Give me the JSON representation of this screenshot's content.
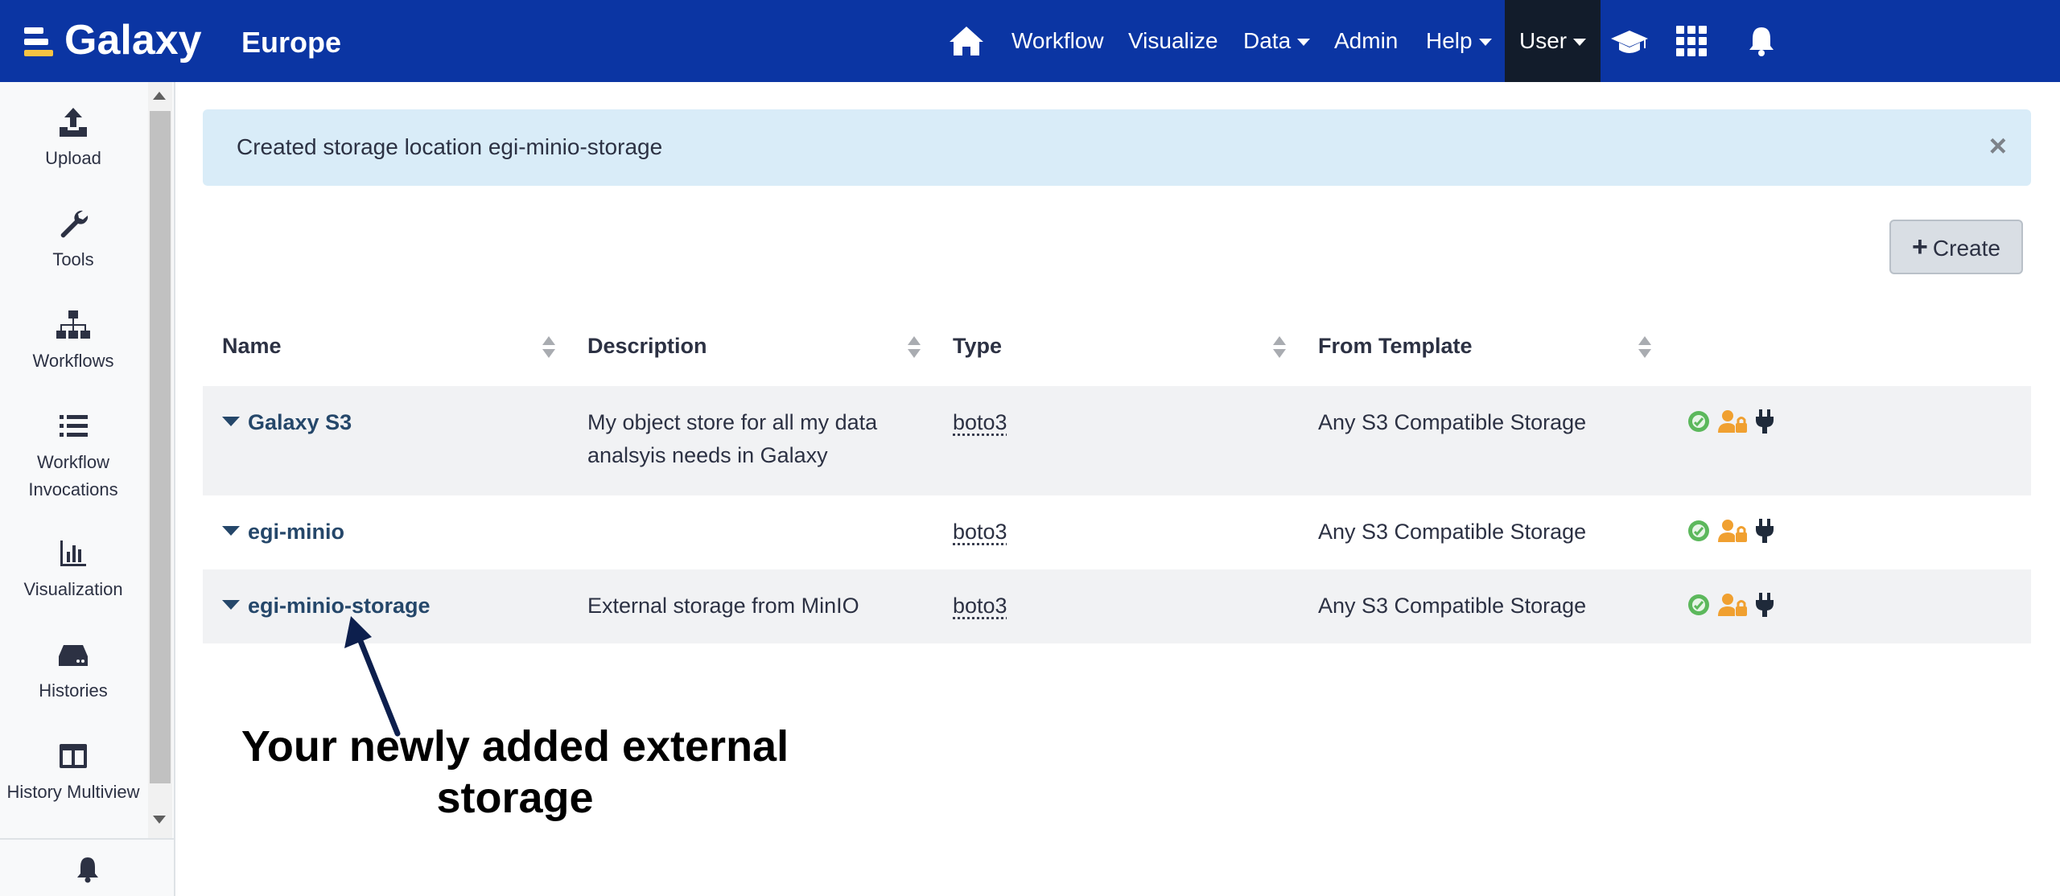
{
  "masthead": {
    "brand": "Galaxy",
    "subtitle": "Europe",
    "nav": {
      "workflow": "Workflow",
      "visualize": "Visualize",
      "data": "Data",
      "admin": "Admin",
      "help": "Help",
      "user": "User"
    },
    "icons": [
      "home-icon",
      "graduation-cap-icon",
      "apps-grid-icon",
      "bell-icon"
    ]
  },
  "activity_bar": {
    "items": [
      {
        "label": "Upload",
        "icon": "upload-icon"
      },
      {
        "label": "Tools",
        "icon": "wrench-icon"
      },
      {
        "label": "Workflows",
        "icon": "sitemap-icon"
      },
      {
        "label": "Workflow Invocations",
        "icon": "list-icon"
      },
      {
        "label": "Visualization",
        "icon": "chart-bar-icon"
      },
      {
        "label": "Histories",
        "icon": "hdd-icon"
      },
      {
        "label": "History Multiview",
        "icon": "columns-icon"
      }
    ],
    "bottom_icon": "bell-icon"
  },
  "alert": {
    "text": "Created storage location egi-minio-storage",
    "close": "×"
  },
  "create_button": {
    "icon": "+",
    "label": "Create"
  },
  "table": {
    "columns": [
      "Name",
      "Description",
      "Type",
      "From Template"
    ],
    "rows": [
      {
        "name": "Galaxy S3",
        "description_line1": "My object store for all my data",
        "description_line2": "analsyis needs in Galaxy",
        "type": "boto3",
        "template": "Any S3 Compatible Storage",
        "badges": [
          "status-ok-icon",
          "user-lock-icon",
          "plug-icon"
        ]
      },
      {
        "name": "egi-minio",
        "description_line1": "",
        "description_line2": "",
        "type": "boto3",
        "template": "Any S3 Compatible Storage",
        "badges": [
          "status-ok-icon",
          "user-lock-icon",
          "plug-icon"
        ]
      },
      {
        "name": "egi-minio-storage",
        "description_line1": "External storage from MinIO",
        "description_line2": "",
        "type": "boto3",
        "template": "Any S3 Compatible Storage",
        "badges": [
          "status-ok-icon",
          "user-lock-icon",
          "plug-icon"
        ]
      }
    ]
  },
  "annotation": {
    "line1": "Your newly added external",
    "line2": "storage"
  },
  "colors": {
    "masthead": "#0b35a3",
    "user_tab": "#121c2b",
    "alert_bg": "#d9ecf8",
    "link": "#25476a",
    "badge_green": "#5cb85c",
    "badge_orange": "#f0a030"
  }
}
